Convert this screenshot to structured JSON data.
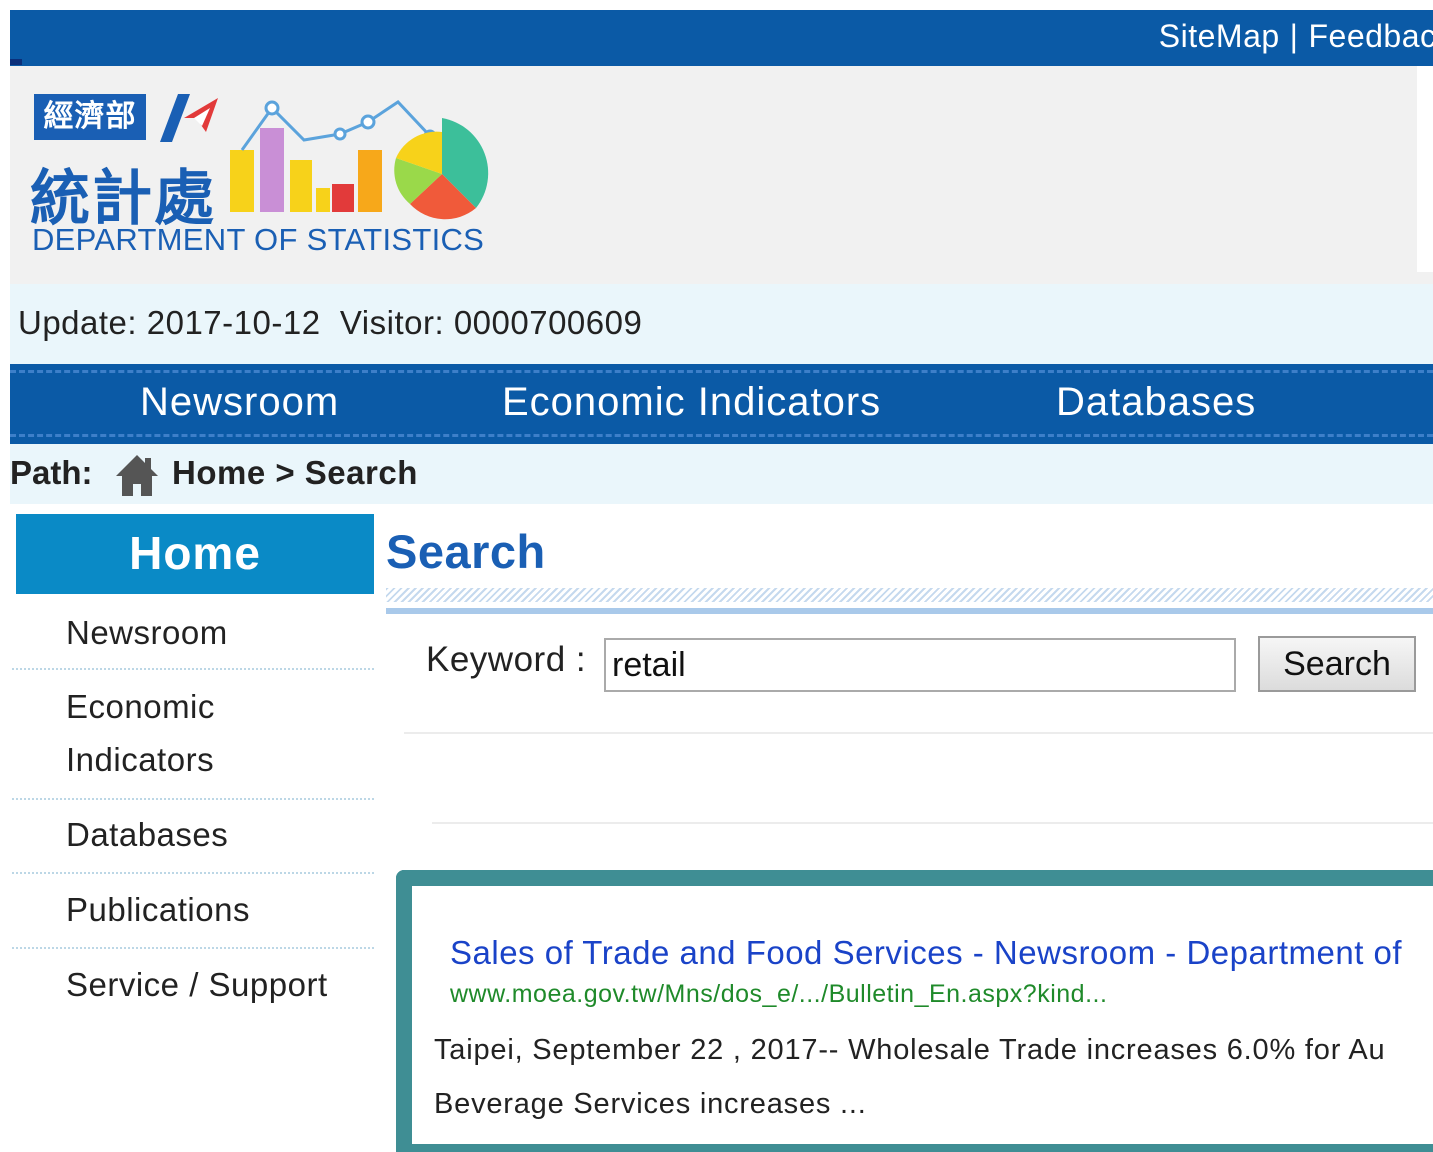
{
  "topbar": {
    "sitemap": "SiteMap",
    "separator": "|",
    "feedback": "Feedback"
  },
  "logo": {
    "badge": "經濟部",
    "chinese_name": "統計處",
    "english_name": "DEPARTMENT OF STATISTICS"
  },
  "status": {
    "text": "Update: 2017-10-12  Visitor: 0000700609"
  },
  "main_nav": {
    "items": [
      "Newsroom",
      "Economic Indicators",
      "Databases"
    ]
  },
  "path": {
    "label": "Path:",
    "crumbs": "Home > Search"
  },
  "sidebar": {
    "header": "Home",
    "items": [
      "Newsroom",
      "Economic",
      "Indicators",
      "Databases",
      "Publications",
      "Service / Support"
    ]
  },
  "content": {
    "title": "Search",
    "keyword_label": "Keyword :",
    "keyword_value": "retail",
    "search_button": "Search"
  },
  "result": {
    "title": "Sales of Trade and Food Services - Newsroom - Department of",
    "url": "www.moea.gov.tw/Mns/dos_e/.../Bulletin_En.aspx?kind...",
    "snippet_line1": "Taipei, September 22 , 2017-- Wholesale Trade increases 6.0% for Au",
    "snippet_line2": "Beverage Services increases ..."
  },
  "colors": {
    "brand_blue": "#0b5aa6",
    "sidebar_header": "#0a8ac6",
    "light_band": "#eaf6fb",
    "result_border": "#3f8e94",
    "link_blue": "#1a43c8",
    "url_green": "#1f8a2a"
  }
}
